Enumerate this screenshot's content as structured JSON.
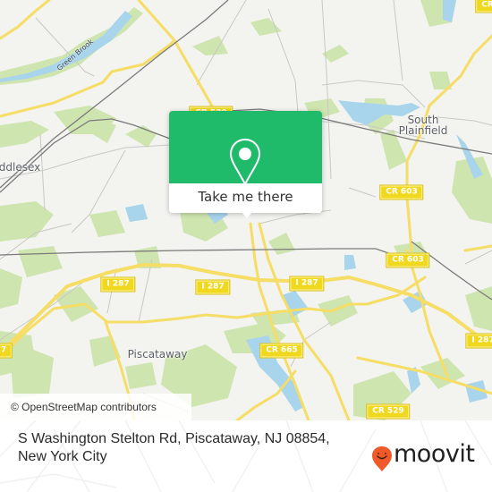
{
  "map": {
    "place_labels": [
      {
        "id": "south-plainfield",
        "text": "South Plainfield"
      },
      {
        "id": "middlesex",
        "text": "ddlesex"
      },
      {
        "id": "piscataway",
        "text": "Piscataway"
      },
      {
        "id": "brook-top",
        "text": "Brook"
      }
    ],
    "water_labels": [
      {
        "id": "green-brook",
        "text": "Green Brook"
      }
    ],
    "road_shields": [
      {
        "id": "cr-top-center",
        "text": "CR 529"
      },
      {
        "id": "cr-top-right",
        "text": "CR"
      },
      {
        "id": "cr603-a",
        "text": "CR 603"
      },
      {
        "id": "cr603-b",
        "text": "CR 603"
      },
      {
        "id": "i287-a",
        "text": "I 287"
      },
      {
        "id": "i287-b",
        "text": "I 287"
      },
      {
        "id": "i287-c",
        "text": "I 287"
      },
      {
        "id": "i287-d",
        "text": "I 287"
      },
      {
        "id": "i287-left",
        "text": "7"
      },
      {
        "id": "cr665",
        "text": "CR 665"
      },
      {
        "id": "cr529",
        "text": "CR 529"
      },
      {
        "id": "cr609",
        "text": "CR 609"
      }
    ],
    "colors": {
      "land": "#f3f3ef",
      "park": "#cfe5b0",
      "water": "#a8d4ec",
      "road_major": "#f5dd66",
      "road_minor": "#c8c8c4",
      "rail": "#7a7a7a",
      "shield": "#f0d81e"
    }
  },
  "popup": {
    "icon": "map-pin-icon",
    "button_label": "Take me there",
    "color": "#1fba6a"
  },
  "attribution": "© OpenStreetMap contributors",
  "footer": {
    "address": "S Washington Stelton Rd, Piscataway, NJ 08854, New York City",
    "brand": "moovit",
    "brand_color": "#f0592a"
  }
}
